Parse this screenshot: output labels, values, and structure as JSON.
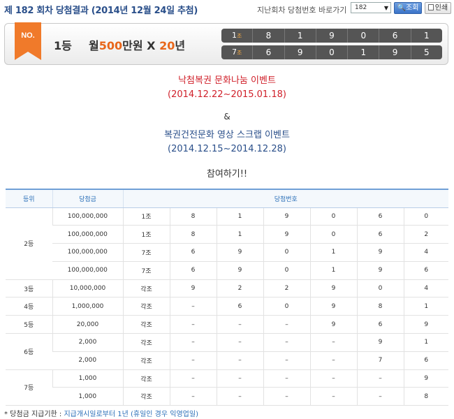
{
  "header": {
    "title": "제 182 회차 당첨결과 (2014년 12월 24일 추첨)",
    "nav_label": "지난회차 당첨번호 바로가기",
    "selected_round": "182",
    "search_button": "조회",
    "print_button": "인쇄"
  },
  "banner": {
    "badge": "NO.",
    "rank": "1등",
    "prize_prefix": "월",
    "prize_amount": "500",
    "prize_unit": "만원",
    "prize_mult": "X",
    "prize_years": "20",
    "prize_years_unit": "년",
    "rows": [
      {
        "group": "1",
        "group_unit": "조",
        "numbers": [
          "8",
          "1",
          "9",
          "0",
          "6",
          "1"
        ]
      },
      {
        "group": "7",
        "group_unit": "조",
        "numbers": [
          "6",
          "9",
          "0",
          "1",
          "9",
          "5"
        ]
      }
    ]
  },
  "events": {
    "event1_title": "낙첨복권 문화나눔 이벤트",
    "event1_dates": "(2014.12.22~2015.01.18)",
    "ampersand": "&",
    "event2_title": "복권건전문화 영상 스크랩 이벤트",
    "event2_dates": "(2014.12.15~2014.12.28)",
    "join": "참여하기!!"
  },
  "table": {
    "headers": {
      "rank": "등위",
      "amount": "당첨금",
      "numbers": "당첨번호"
    },
    "groups": [
      {
        "rank": "2등",
        "rows": [
          {
            "amount": "100,000,000",
            "group": "1조",
            "numbers": [
              "8",
              "1",
              "9",
              "0",
              "6",
              "0"
            ]
          },
          {
            "amount": "100,000,000",
            "group": "1조",
            "numbers": [
              "8",
              "1",
              "9",
              "0",
              "6",
              "2"
            ]
          },
          {
            "amount": "100,000,000",
            "group": "7조",
            "numbers": [
              "6",
              "9",
              "0",
              "1",
              "9",
              "4"
            ]
          },
          {
            "amount": "100,000,000",
            "group": "7조",
            "numbers": [
              "6",
              "9",
              "0",
              "1",
              "9",
              "6"
            ]
          }
        ]
      },
      {
        "rank": "3등",
        "rows": [
          {
            "amount": "10,000,000",
            "group": "각조",
            "numbers": [
              "9",
              "2",
              "2",
              "9",
              "0",
              "4"
            ]
          }
        ]
      },
      {
        "rank": "4등",
        "rows": [
          {
            "amount": "1,000,000",
            "group": "각조",
            "numbers": [
              "–",
              "6",
              "0",
              "9",
              "8",
              "1"
            ]
          }
        ]
      },
      {
        "rank": "5등",
        "rows": [
          {
            "amount": "20,000",
            "group": "각조",
            "numbers": [
              "–",
              "–",
              "–",
              "9",
              "6",
              "9"
            ]
          }
        ]
      },
      {
        "rank": "6등",
        "rows": [
          {
            "amount": "2,000",
            "group": "각조",
            "numbers": [
              "–",
              "–",
              "–",
              "–",
              "9",
              "1"
            ]
          },
          {
            "amount": "2,000",
            "group": "각조",
            "numbers": [
              "–",
              "–",
              "–",
              "–",
              "7",
              "6"
            ]
          }
        ]
      },
      {
        "rank": "7등",
        "rows": [
          {
            "amount": "1,000",
            "group": "각조",
            "numbers": [
              "–",
              "–",
              "–",
              "–",
              "–",
              "9"
            ]
          },
          {
            "amount": "1,000",
            "group": "각조",
            "numbers": [
              "–",
              "–",
              "–",
              "–",
              "–",
              "8"
            ]
          }
        ]
      }
    ]
  },
  "footnote": {
    "label": "* 당첨금 지급기한 : ",
    "text": "지급개시일로부터 1년 (휴일인 경우 익영업일)"
  },
  "colors": {
    "title": "#2a4f8a",
    "accent_orange": "#e8661a",
    "event_red": "#d0202a",
    "table_header": "#2a6fb8"
  }
}
